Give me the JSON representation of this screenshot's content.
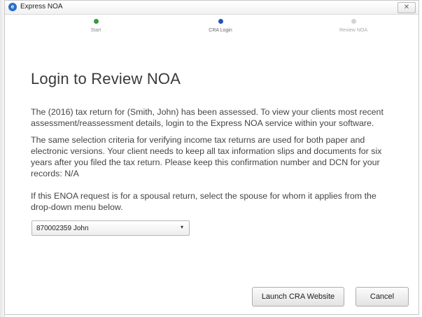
{
  "window": {
    "title": "Express NOA",
    "app_icon_glyph": "e",
    "close_glyph": "✕"
  },
  "stepper": {
    "steps": [
      {
        "label": "Start",
        "state": "completed",
        "color": "#3a9a3a"
      },
      {
        "label": "CRA Login",
        "state": "current",
        "color": "#1f55b8"
      },
      {
        "label": "Review NOA",
        "state": "pending",
        "color": "#d3d3d3"
      }
    ]
  },
  "main": {
    "title": "Login to Review NOA",
    "paragraph_1": "The (2016) tax return for (Smith, John) has been assessed. To view your clients most recent assessment/reassessment details, login to the Express NOA service within your software.",
    "paragraph_2": "The same selection criteria for verifying income tax returns are used for both paper and electronic versions. Your client needs to keep all tax information slips and documents for six years after you filed the tax return. Please keep this confirmation number and DCN for your records: N/A",
    "paragraph_3": "If this ENOA request is for a spousal return, select the spouse for whom it applies from the drop-down menu below.",
    "spouse_select": {
      "selected": "870002359  John",
      "caret_glyph": "▾"
    }
  },
  "footer": {
    "launch_label": "Launch CRA Website",
    "cancel_label": "Cancel"
  },
  "icons": {
    "app": "express-noa-icon",
    "close": "close-icon",
    "dropdown": "chevron-down-icon"
  }
}
